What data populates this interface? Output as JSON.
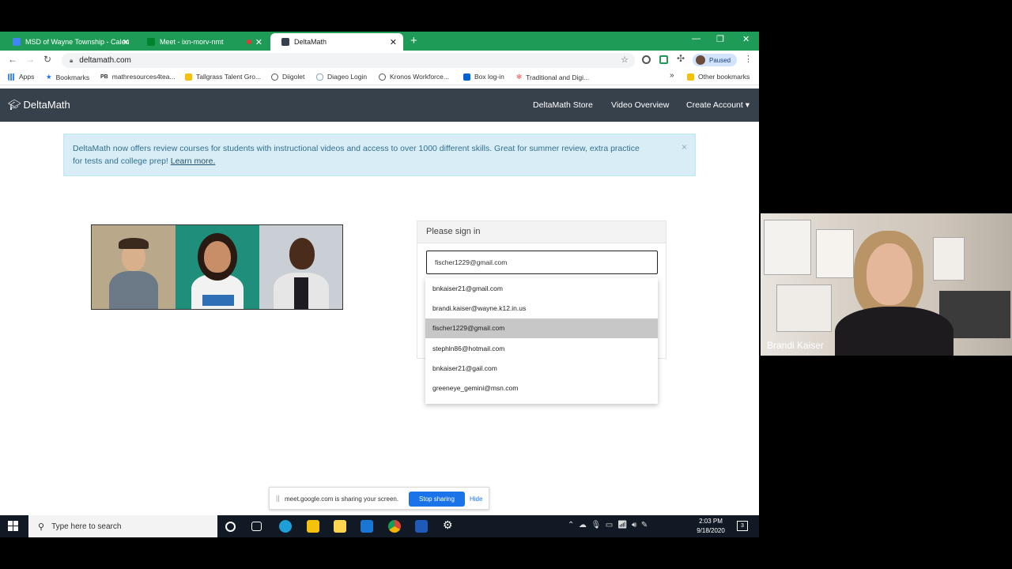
{
  "browser": {
    "tabs": [
      {
        "title": "MSD of Wayne Township - Calen",
        "favicon_color": "#4285f4"
      },
      {
        "title": "Meet - ixn-morv-nmt",
        "favicon_color": "#00832d"
      },
      {
        "title": "DeltaMath",
        "favicon_color": "#37414c"
      }
    ],
    "url": "deltamath.com",
    "profile_status": "Paused",
    "bookmarks": [
      {
        "label": "Apps",
        "icon": "apps-grid-icon"
      },
      {
        "label": "Bookmarks",
        "icon": "star-icon"
      },
      {
        "label": "mathresources4tea...",
        "icon": "pb-icon"
      },
      {
        "label": "Tallgrass Talent Gro...",
        "icon": "folder-icon"
      },
      {
        "label": "Diigolet",
        "icon": "globe-icon"
      },
      {
        "label": "Diageo Login",
        "icon": "cloud-icon"
      },
      {
        "label": "Kronos Workforce...",
        "icon": "globe-icon"
      },
      {
        "label": "Box log-in",
        "icon": "box-icon"
      },
      {
        "label": "Traditional and Digi...",
        "icon": "pinwheel-icon"
      },
      {
        "label": "Other bookmarks",
        "icon": "folder-icon"
      }
    ],
    "more_bookmarks": "»"
  },
  "deltamath": {
    "brand": "DeltaMath",
    "nav": {
      "store": "DeltaMath Store",
      "video": "Video Overview",
      "create": "Create Account ▾"
    },
    "alert": {
      "text": "DeltaMath now offers review courses for students with instructional videos and access to over 1000 different skills. Great for summer review, extra practice for tests and college prep! ",
      "link": "Learn more.",
      "close": "×"
    },
    "signin": {
      "heading": "Please sign in",
      "email_value": "fischer1229@gmail.com"
    },
    "autocomplete": [
      "bnkaiser21@gmail.com",
      "brandi.kaiser@wayne.k12.in.us",
      "fischer1229@gmail.com",
      "stephln86@hotmail.com",
      "bnkaiser21@gail.com",
      "greeneye_gemini@msn.com"
    ],
    "autocomplete_selected_index": 2
  },
  "share_bar": {
    "message": "meet.google.com is sharing your screen.",
    "stop": "Stop sharing",
    "hide": "Hide"
  },
  "taskbar": {
    "search_placeholder": "Type here to search",
    "time": "2:03 PM",
    "date": "9/18/2020",
    "notifications": "3"
  },
  "webcam": {
    "participant_name": "Brandi Kaiser"
  }
}
